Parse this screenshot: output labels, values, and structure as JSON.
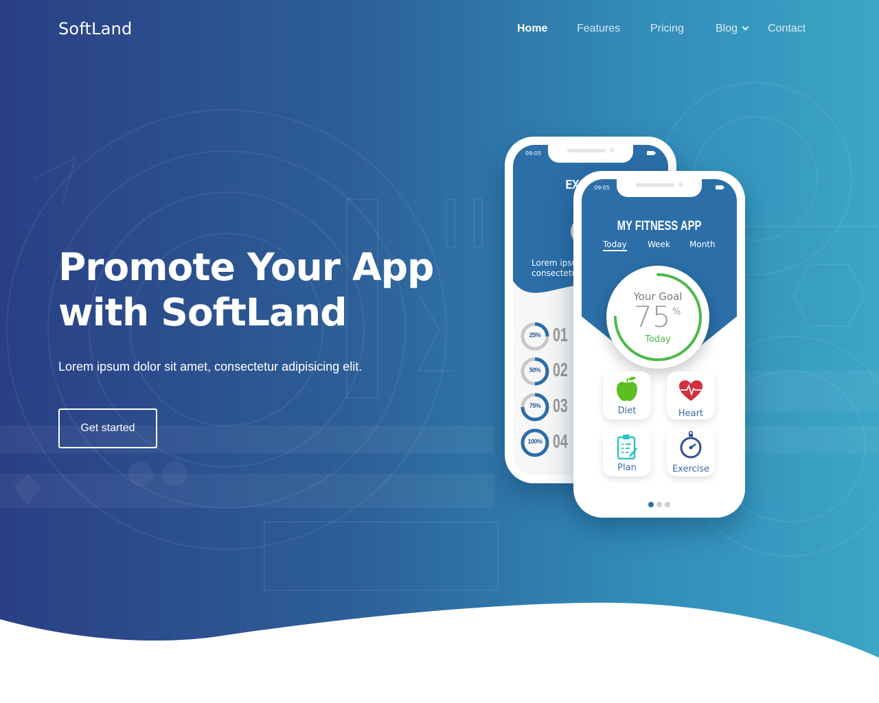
{
  "header": {
    "logo": "SoftLand",
    "nav": [
      {
        "label": "Home",
        "active": true
      },
      {
        "label": "Features",
        "active": false
      },
      {
        "label": "Pricing",
        "active": false
      },
      {
        "label": "Blog",
        "active": false,
        "has_dropdown": true
      },
      {
        "label": "Contact",
        "active": false
      }
    ]
  },
  "hero": {
    "headline_line1": "Promote Your App",
    "headline_line2": "with SoftLand",
    "subtext": "Lorem ipsum dolor sit amet, consectetur adipisicing elit.",
    "cta_label": "Get started"
  },
  "colors": {
    "gradient_start": "#2a3f85",
    "gradient_end": "#3ba6c6",
    "phone_blue": "#2b6ea8",
    "goal_green": "#4cb848"
  },
  "phone_back": {
    "status_time": "09:05",
    "title_partial": "EX",
    "lorem_line1": "Lorem ipsu",
    "lorem_line2": "consectetu",
    "progress_items": [
      {
        "percent_label": "25%",
        "value": 0.25,
        "number": "01"
      },
      {
        "percent_label": "50%",
        "value": 0.5,
        "number": "02"
      },
      {
        "percent_label": "75%",
        "value": 0.75,
        "number": "03"
      },
      {
        "percent_label": "100%",
        "value": 1.0,
        "number": "04"
      }
    ]
  },
  "phone_front": {
    "status_time": "09:05",
    "app_title": "MY FITNESS APP",
    "tabs": [
      {
        "label": "Today",
        "active": true
      },
      {
        "label": "Week",
        "active": false
      },
      {
        "label": "Month",
        "active": false
      }
    ],
    "goal": {
      "label": "Your Goal",
      "value": "75",
      "unit": "%",
      "sub": "Today",
      "progress": 0.75
    },
    "tiles": [
      {
        "label": "Diet",
        "icon": "apple-icon"
      },
      {
        "label": "Heart",
        "icon": "heart-pulse-icon"
      },
      {
        "label": "Plan",
        "icon": "clipboard-icon"
      },
      {
        "label": "Exercise",
        "icon": "stopwatch-icon"
      }
    ],
    "pager": {
      "count": 3,
      "active_index": 0
    }
  }
}
